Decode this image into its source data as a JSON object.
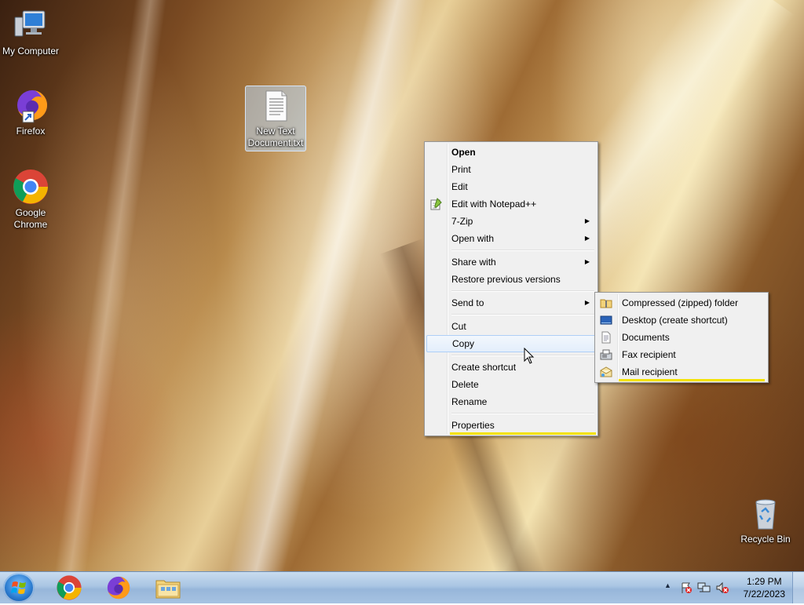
{
  "desktop_icons": [
    {
      "label": "My Computer",
      "icon": "computer-icon"
    },
    {
      "label": "Firefox",
      "icon": "firefox-icon"
    },
    {
      "label": "Google Chrome",
      "icon": "chrome-icon"
    },
    {
      "label": "New Text Document.txt",
      "icon": "text-file-icon"
    },
    {
      "label": "Recycle Bin",
      "icon": "recycle-bin-icon"
    }
  ],
  "context_menu": {
    "items": [
      {
        "label": "Open",
        "bold": true
      },
      {
        "label": "Print"
      },
      {
        "label": "Edit"
      },
      {
        "label": "Edit with Notepad++",
        "icon": "notepad-plus-plus-icon"
      },
      {
        "label": "7-Zip",
        "submenu": true
      },
      {
        "label": "Open with",
        "submenu": true
      },
      {
        "label": "Share with",
        "submenu": true
      },
      {
        "label": "Restore previous versions"
      },
      {
        "label": "Send to",
        "submenu": true
      },
      {
        "label": "Cut"
      },
      {
        "label": "Copy"
      },
      {
        "label": "Create shortcut"
      },
      {
        "label": "Delete"
      },
      {
        "label": "Rename"
      },
      {
        "label": "Properties"
      }
    ]
  },
  "send_to_menu": {
    "items": [
      {
        "label": "Compressed (zipped) folder",
        "icon": "zip-folder-icon"
      },
      {
        "label": "Desktop (create shortcut)",
        "icon": "desktop-icon"
      },
      {
        "label": "Documents",
        "icon": "documents-icon"
      },
      {
        "label": "Fax recipient",
        "icon": "fax-icon"
      },
      {
        "label": "Mail recipient",
        "icon": "mail-icon"
      }
    ]
  },
  "taskbar": {
    "pinned": [
      "start-orb-icon",
      "chrome-icon",
      "firefox-icon",
      "file-explorer-icon"
    ],
    "tray_icons": [
      "show-hidden-icons-chevron",
      "action-center-flag-icon",
      "network-icon",
      "volume-muted-icon"
    ],
    "clock_time": "1:29 PM",
    "clock_date": "7/22/2023"
  },
  "colors": {
    "menu_bg": "#f0f0f0",
    "menu_border": "#979797",
    "hover_bg": "#e3eefb",
    "highlight_underline": "#f3e200",
    "taskbar": "#a9c5e3"
  }
}
